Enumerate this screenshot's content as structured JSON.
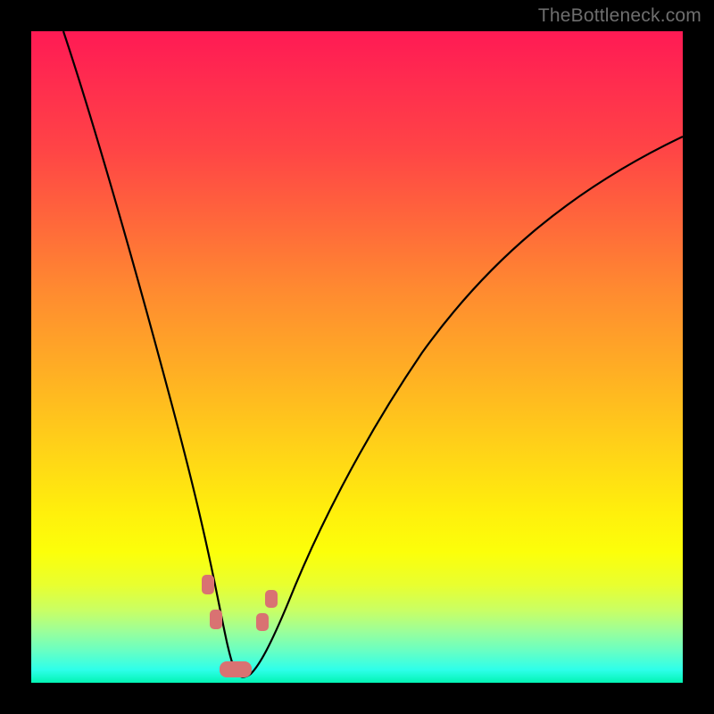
{
  "watermark": "TheBottleneck.com",
  "colors": {
    "frame_bg": "#000000",
    "curve": "#000000",
    "marker": "#d97272",
    "gradient_stops": [
      "#ff1a54",
      "#ff2850",
      "#ff4446",
      "#ff6a3a",
      "#ff8b30",
      "#ffae24",
      "#ffd218",
      "#fff00c",
      "#fcff0a",
      "#e8ff30",
      "#c8ff66",
      "#9dff98",
      "#6affc2",
      "#2effea",
      "#02f4b3"
    ]
  },
  "chart_data": {
    "type": "line",
    "title": "",
    "xlabel": "",
    "ylabel": "",
    "x_range": [
      0,
      100
    ],
    "y_range": [
      0,
      100
    ],
    "note": "Axes are unlabeled; x and y are normalized percentages inferred from position within the gradient plot area. y=100 is top (worst/red), y=0 is bottom (best/green). Curve is a V-shaped bottleneck profile.",
    "series": [
      {
        "name": "bottleneck-curve",
        "x": [
          5,
          8,
          12,
          16,
          20,
          24,
          27,
          29,
          30,
          31,
          32,
          34,
          38,
          42,
          48,
          56,
          66,
          78,
          90,
          100
        ],
        "y": [
          100,
          90,
          78,
          64,
          48,
          30,
          14,
          6,
          2,
          1,
          2,
          6,
          14,
          24,
          36,
          48,
          58,
          66,
          71,
          74
        ]
      }
    ],
    "markers": [
      {
        "name": "marker-left-upper",
        "x": 26.0,
        "y": 16
      },
      {
        "name": "marker-left-lower",
        "x": 27.5,
        "y": 10
      },
      {
        "name": "marker-bottom-bar",
        "x_start": 29.0,
        "x_end": 33.0,
        "y": 2
      },
      {
        "name": "marker-right-lower",
        "x": 34.5,
        "y": 9
      },
      {
        "name": "marker-right-upper",
        "x": 36.0,
        "y": 13
      }
    ]
  }
}
